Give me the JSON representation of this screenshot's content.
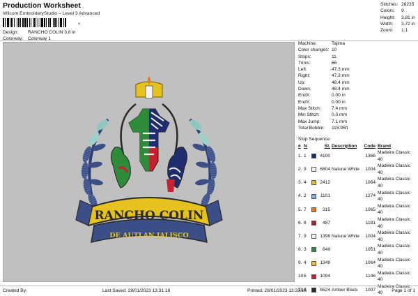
{
  "header": {
    "title": "Production Worksheet",
    "subtitle": "Wilcom EmbroideryStudio – Level 3 Advanced",
    "barcode_suffix": ",",
    "design_label": "Design:",
    "design_value": "RANCHO COLIN 3,8 in",
    "colorway_label": "Colorway:",
    "colorway_value": "Colorway 1"
  },
  "stats": {
    "stitches_label": "Stitches:",
    "stitches": "26235",
    "colors_label": "Colors:",
    "colors": "9",
    "height_label": "Height:",
    "height": "3.81 in",
    "width_label": "Width:",
    "width": "3.72 in",
    "zoom_label": "Zoom:",
    "zoom": "1:1"
  },
  "machine_info": {
    "machine_label": "Machine:",
    "machine": "Tajima",
    "color_changes_label": "Color changes:",
    "color_changes": "10",
    "stops_label": "Stops:",
    "stops": "11",
    "trims_label": "Trims:",
    "trims": "66",
    "left_label": "Left:",
    "left": "47.3 mm",
    "right_label": "Right:",
    "right": "47.3 mm",
    "up_label": "Up:",
    "up": "48.4 mm",
    "down_label": "Down:",
    "down": "48.4 mm",
    "endx_label": "EndX:",
    "endx": "0.00 in",
    "endy_label": "EndY:",
    "endy": "0.00 in",
    "max_stitch_label": "Max Stitch:",
    "max_stitch": "7.4 mm",
    "min_stitch_label": "Min Stitch:",
    "min_stitch": "0.0 mm",
    "max_jump_label": "Max Jump:",
    "max_jump": "7.1 mm",
    "total_bobbin_label": "Total Bobbin:",
    "total_bobbin": "115.95ft"
  },
  "stop_sequence": {
    "label": "Stop Sequence:",
    "headers": {
      "num": "#",
      "n": "N",
      "st": "St.",
      "description": "Description",
      "code": "Code",
      "brand": "Brand"
    },
    "rows": [
      {
        "num": "1.",
        "n": "1",
        "color": "#1f2d6e",
        "st": "4100",
        "desc": "",
        "code": "1366",
        "brand": "Madeira Classic 40"
      },
      {
        "num": "2.",
        "n": "9",
        "color": "#f2f2f2",
        "st": "6804",
        "desc": "Natural White",
        "code": "1004",
        "brand": "Madeira Classic 40"
      },
      {
        "num": "3.",
        "n": "4",
        "color": "#e6c21e",
        "st": "2412",
        "desc": "",
        "code": "1064",
        "brand": "Madeira Classic 40"
      },
      {
        "num": "4.",
        "n": "2",
        "color": "#7fa8d8",
        "st": "1101",
        "desc": "",
        "code": "1274",
        "brand": "Madeira Classic 40"
      },
      {
        "num": "5.",
        "n": "7",
        "color": "#e87722",
        "st": "315",
        "desc": "",
        "code": "1065",
        "brand": "Madeira Classic 40"
      },
      {
        "num": "6.",
        "n": "6",
        "color": "#b0202a",
        "st": "487",
        "desc": "",
        "code": "1181",
        "brand": "Madeira Classic 40"
      },
      {
        "num": "7.",
        "n": "9",
        "color": "#f2f2f2",
        "st": "1398",
        "desc": "Natural White",
        "code": "1004",
        "brand": "Madeira Classic 40"
      },
      {
        "num": "8.",
        "n": "3",
        "color": "#2e8b3a",
        "st": "649",
        "desc": "",
        "code": "1051",
        "brand": "Madeira Classic 40"
      },
      {
        "num": "9.",
        "n": "4",
        "color": "#e6c21e",
        "st": "1349",
        "desc": "",
        "code": "1064",
        "brand": "Madeira Classic 40"
      },
      {
        "num": "10.",
        "n": "5",
        "color": "#c8202e",
        "st": "1094",
        "desc": "",
        "code": "1146",
        "brand": "Madeira Classic 40"
      },
      {
        "num": "11.",
        "n": "8",
        "color": "#2a2a2a",
        "st": "6524",
        "desc": "Amber Black",
        "code": "1007",
        "brand": "Madeira Classic 40"
      }
    ]
  },
  "design_preview": {
    "banner_top": "RANCHO COLIN",
    "banner_bottom": "DE AUTLAN JALISCO"
  },
  "footer": {
    "created_by": "Created By:",
    "last_saved": "Last Saved: 28/01/2023 13:31:18",
    "printed": "Printed: 28/01/2023 13:33:16",
    "page": "Page 1 of 1"
  }
}
